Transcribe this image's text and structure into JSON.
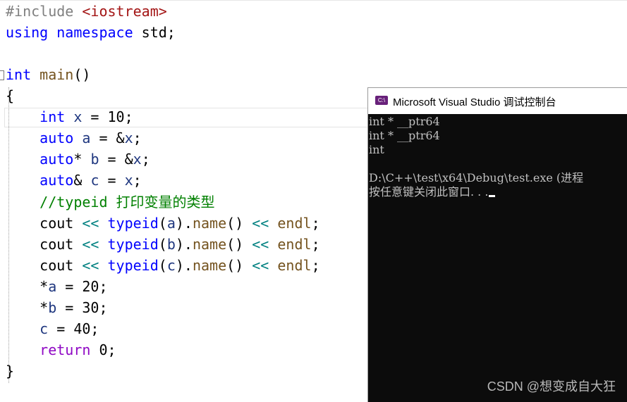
{
  "editor": {
    "lines": [
      {
        "tokens": [
          {
            "t": "#include ",
            "c": "pp"
          },
          {
            "t": "<iostream>",
            "c": "str"
          }
        ]
      },
      {
        "tokens": [
          {
            "t": "using",
            "c": "kw"
          },
          {
            "t": " ",
            "c": "plain"
          },
          {
            "t": "namespace",
            "c": "kw"
          },
          {
            "t": " std;",
            "c": "plain"
          }
        ]
      },
      {
        "tokens": []
      },
      {
        "tokens": [
          {
            "t": "int",
            "c": "kw"
          },
          {
            "t": " ",
            "c": "plain"
          },
          {
            "t": "main",
            "c": "fn"
          },
          {
            "t": "()",
            "c": "plain"
          }
        ]
      },
      {
        "tokens": [
          {
            "t": "{",
            "c": "plain"
          }
        ]
      },
      {
        "tokens": [
          {
            "t": "    ",
            "c": "plain"
          },
          {
            "t": "int",
            "c": "kw"
          },
          {
            "t": " ",
            "c": "plain"
          },
          {
            "t": "x",
            "c": "var"
          },
          {
            "t": " = 10;",
            "c": "plain"
          }
        ]
      },
      {
        "tokens": [
          {
            "t": "    ",
            "c": "plain"
          },
          {
            "t": "auto",
            "c": "kw"
          },
          {
            "t": " ",
            "c": "plain"
          },
          {
            "t": "a",
            "c": "var"
          },
          {
            "t": " = &",
            "c": "plain"
          },
          {
            "t": "x",
            "c": "var"
          },
          {
            "t": ";",
            "c": "plain"
          }
        ]
      },
      {
        "tokens": [
          {
            "t": "    ",
            "c": "plain"
          },
          {
            "t": "auto",
            "c": "kw"
          },
          {
            "t": "* ",
            "c": "plain"
          },
          {
            "t": "b",
            "c": "var"
          },
          {
            "t": " = &",
            "c": "plain"
          },
          {
            "t": "x",
            "c": "var"
          },
          {
            "t": ";",
            "c": "plain"
          }
        ]
      },
      {
        "tokens": [
          {
            "t": "    ",
            "c": "plain"
          },
          {
            "t": "auto",
            "c": "kw"
          },
          {
            "t": "& ",
            "c": "plain"
          },
          {
            "t": "c",
            "c": "var"
          },
          {
            "t": " = ",
            "c": "plain"
          },
          {
            "t": "x",
            "c": "var"
          },
          {
            "t": ";",
            "c": "plain"
          }
        ]
      },
      {
        "tokens": [
          {
            "t": "    ",
            "c": "plain"
          },
          {
            "t": "//typeid 打印变量的类型",
            "c": "cm"
          }
        ]
      },
      {
        "tokens": [
          {
            "t": "    cout ",
            "c": "plain"
          },
          {
            "t": "<<",
            "c": "op"
          },
          {
            "t": " ",
            "c": "plain"
          },
          {
            "t": "typeid",
            "c": "kw"
          },
          {
            "t": "(",
            "c": "plain"
          },
          {
            "t": "a",
            "c": "var"
          },
          {
            "t": ").",
            "c": "plain"
          },
          {
            "t": "name",
            "c": "fn"
          },
          {
            "t": "() ",
            "c": "plain"
          },
          {
            "t": "<<",
            "c": "op"
          },
          {
            "t": " ",
            "c": "plain"
          },
          {
            "t": "endl",
            "c": "fn"
          },
          {
            "t": ";",
            "c": "plain"
          }
        ]
      },
      {
        "tokens": [
          {
            "t": "    cout ",
            "c": "plain"
          },
          {
            "t": "<<",
            "c": "op"
          },
          {
            "t": " ",
            "c": "plain"
          },
          {
            "t": "typeid",
            "c": "kw"
          },
          {
            "t": "(",
            "c": "plain"
          },
          {
            "t": "b",
            "c": "var"
          },
          {
            "t": ").",
            "c": "plain"
          },
          {
            "t": "name",
            "c": "fn"
          },
          {
            "t": "() ",
            "c": "plain"
          },
          {
            "t": "<<",
            "c": "op"
          },
          {
            "t": " ",
            "c": "plain"
          },
          {
            "t": "endl",
            "c": "fn"
          },
          {
            "t": ";",
            "c": "plain"
          }
        ]
      },
      {
        "tokens": [
          {
            "t": "    cout ",
            "c": "plain"
          },
          {
            "t": "<<",
            "c": "op"
          },
          {
            "t": " ",
            "c": "plain"
          },
          {
            "t": "typeid",
            "c": "kw"
          },
          {
            "t": "(",
            "c": "plain"
          },
          {
            "t": "c",
            "c": "var"
          },
          {
            "t": ").",
            "c": "plain"
          },
          {
            "t": "name",
            "c": "fn"
          },
          {
            "t": "() ",
            "c": "plain"
          },
          {
            "t": "<<",
            "c": "op"
          },
          {
            "t": " ",
            "c": "plain"
          },
          {
            "t": "endl",
            "c": "fn"
          },
          {
            "t": ";",
            "c": "plain"
          }
        ]
      },
      {
        "tokens": [
          {
            "t": "    *",
            "c": "plain"
          },
          {
            "t": "a",
            "c": "var"
          },
          {
            "t": " = 20;",
            "c": "plain"
          }
        ]
      },
      {
        "tokens": [
          {
            "t": "    *",
            "c": "plain"
          },
          {
            "t": "b",
            "c": "var"
          },
          {
            "t": " = 30;",
            "c": "plain"
          }
        ]
      },
      {
        "tokens": [
          {
            "t": "    ",
            "c": "plain"
          },
          {
            "t": "c",
            "c": "var"
          },
          {
            "t": " = 40;",
            "c": "plain"
          }
        ]
      },
      {
        "tokens": [
          {
            "t": "    ",
            "c": "plain"
          },
          {
            "t": "return",
            "c": "rt"
          },
          {
            "t": " 0;",
            "c": "plain"
          }
        ]
      },
      {
        "tokens": [
          {
            "t": "}",
            "c": "plain"
          }
        ]
      }
    ]
  },
  "console": {
    "title": "Microsoft Visual Studio 调试控制台",
    "icon": "visual-studio-icon",
    "icon_text": "C:\\",
    "output_lines": [
      "int * __ptr64",
      "int * __ptr64",
      "int",
      "",
      "D:\\C++\\test\\x64\\Debug\\test.exe (进程",
      "按任意键关闭此窗口. . ."
    ]
  },
  "watermark": "CSDN @想变成自大狂",
  "colors": {
    "keyword": "#0000ff",
    "variable": "#1f377f",
    "function": "#74531f",
    "preprocessor": "#808080",
    "string": "#a31515",
    "comment": "#008000",
    "operator": "#008080",
    "return_keyword": "#8f08c4",
    "console_bg": "#0c0c0c",
    "console_text": "#c0c0c0"
  }
}
